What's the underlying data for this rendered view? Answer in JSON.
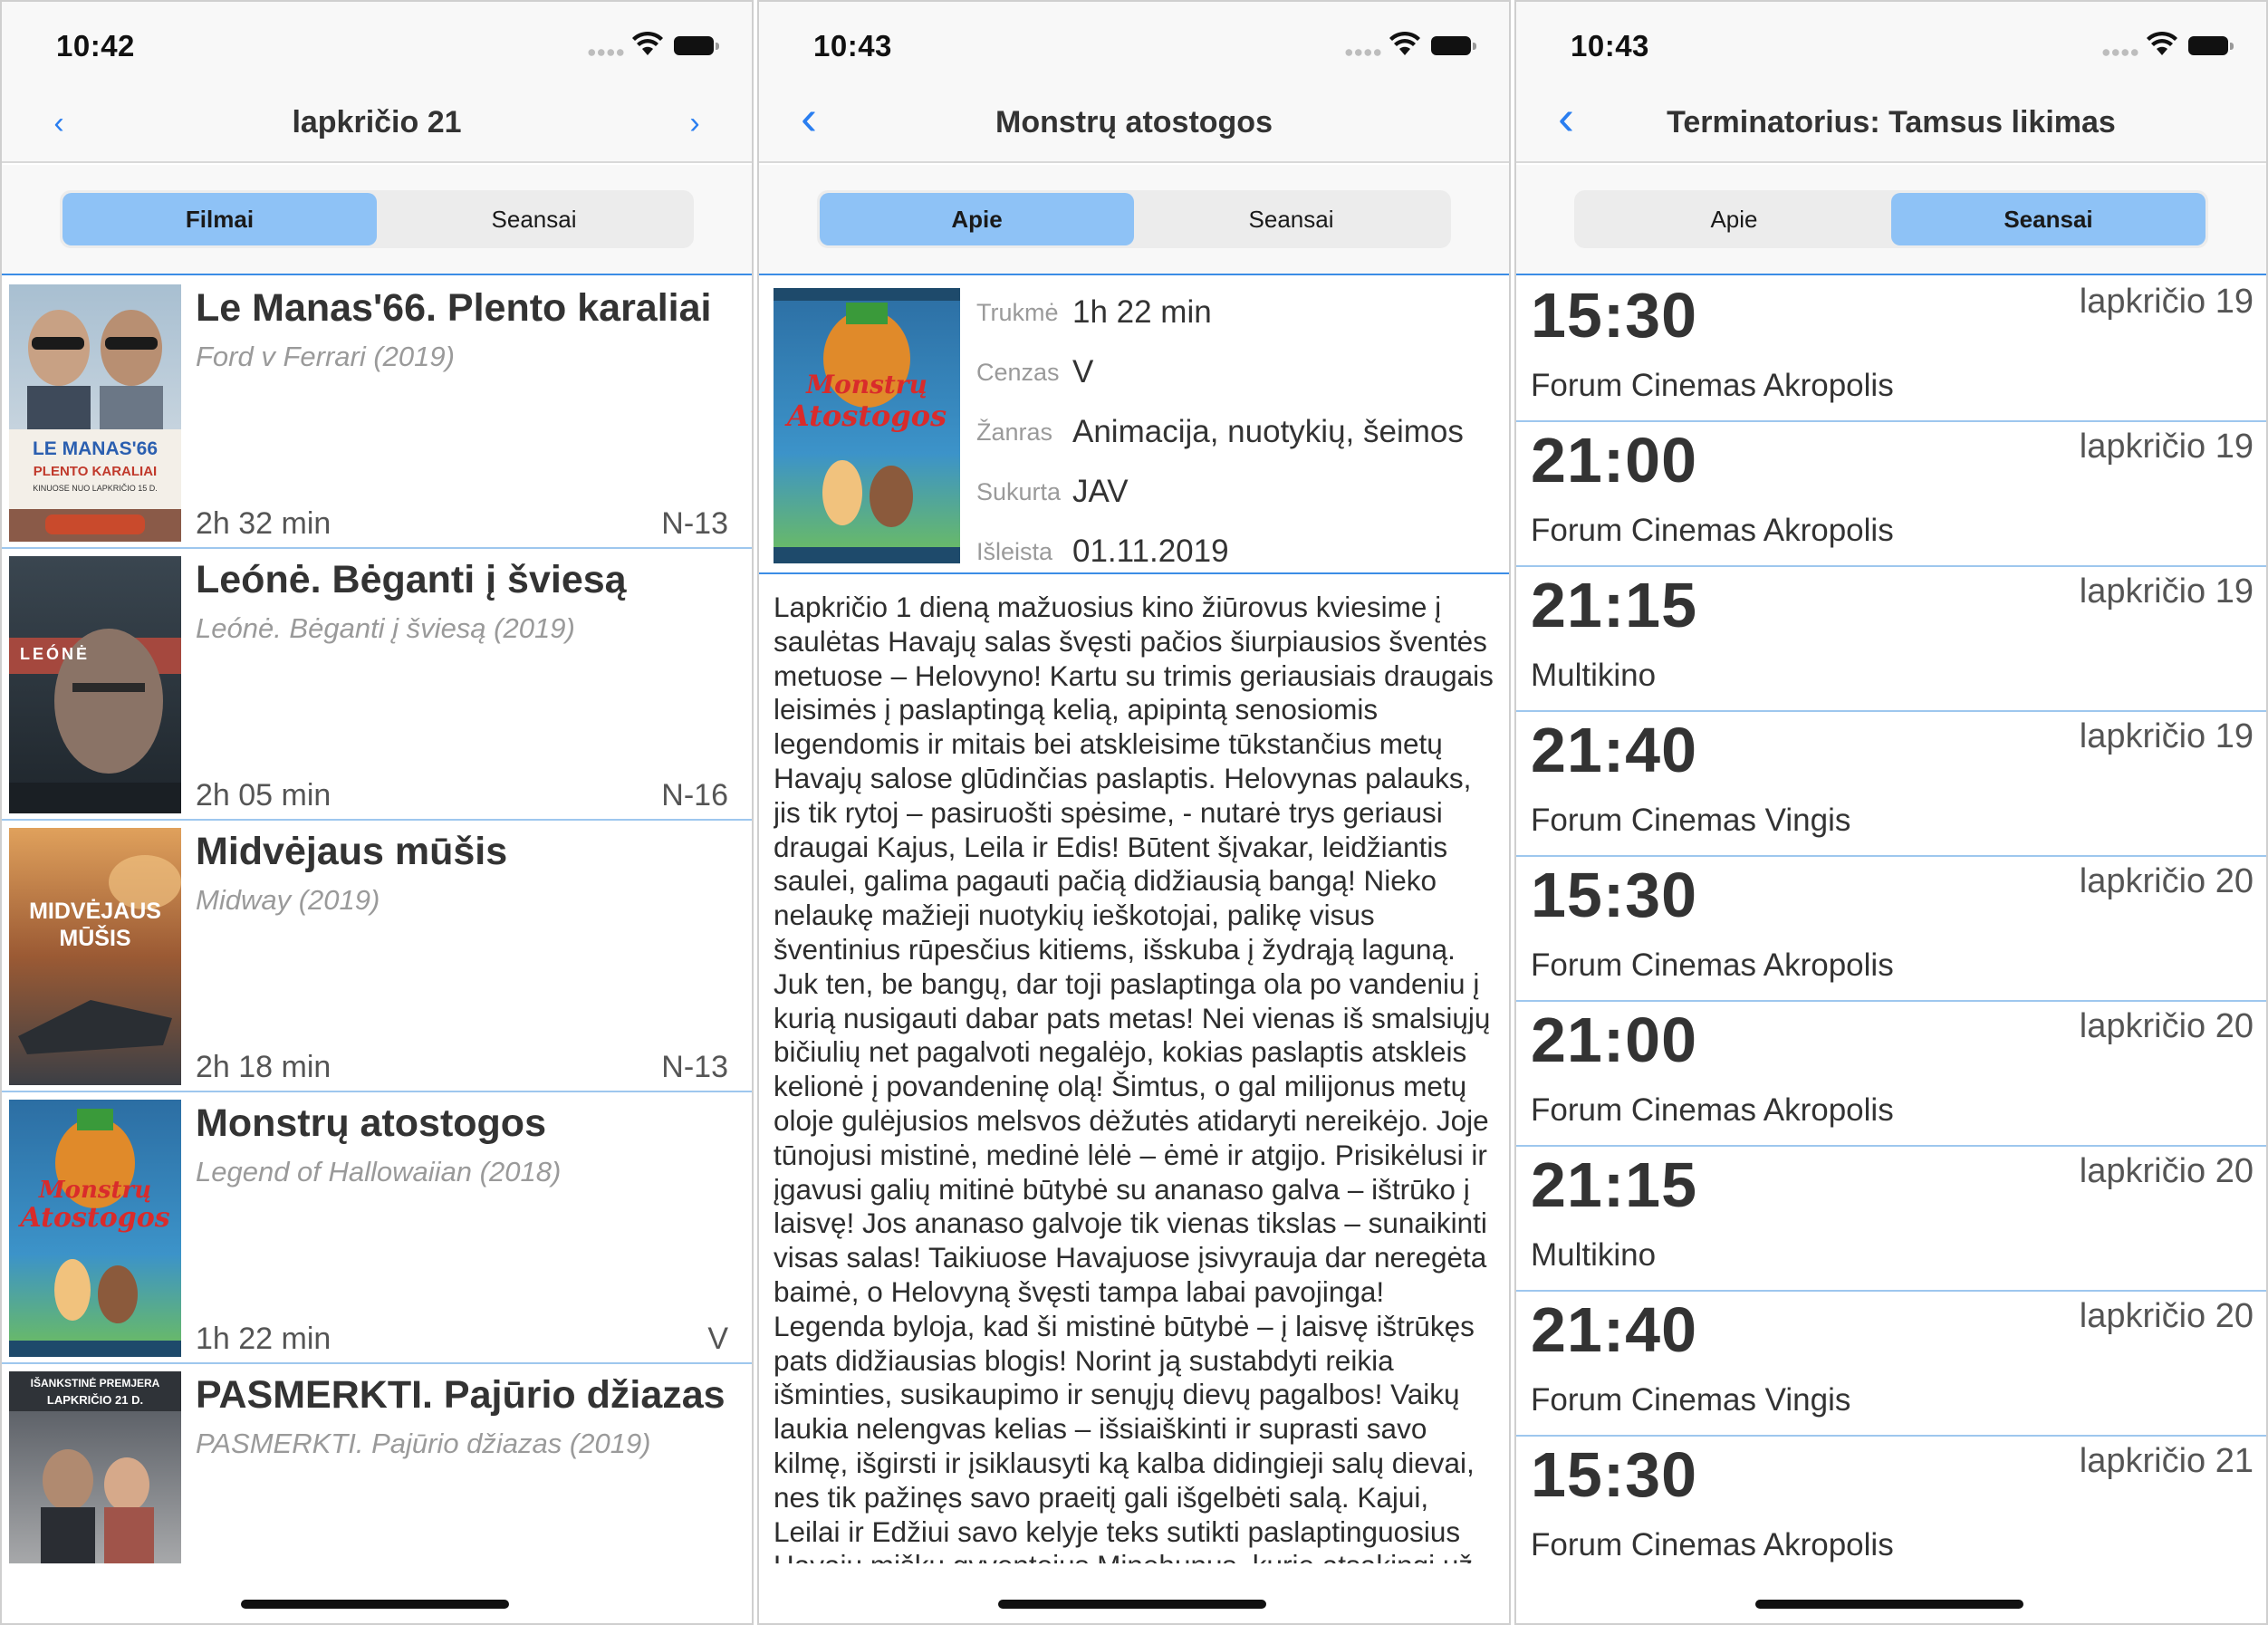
{
  "screens": [
    {
      "status": {
        "time": "10:42"
      },
      "nav": {
        "back": "‹",
        "title": "lapkričio 21",
        "forward": "›"
      },
      "tabs": [
        "Filmai",
        "Seansai"
      ],
      "active_tab": "Filmai",
      "movies": [
        {
          "title": "Le Manas'66. Plento karaliai",
          "original": "Ford v Ferrari (2019)",
          "duration": "2h 32 min",
          "rating": "N-13",
          "poster_text": "LE MANAS'66",
          "poster_sub": "PLENTO KARALIAI",
          "poster_colors": [
            "#9fb6c9",
            "#f0e9df"
          ]
        },
        {
          "title": "Leónė. Bėganti į šviesą",
          "original": "Leónė. Bėganti į šviesą (2019)",
          "duration": "2h 05 min",
          "rating": "N-16",
          "poster_text": "LEÓNĖ",
          "poster_sub": "",
          "poster_colors": [
            "#2f3a44",
            "#6b7780"
          ]
        },
        {
          "title": "Midvėjaus mūšis",
          "original": "Midway (2019)",
          "duration": "2h 18 min",
          "rating": "N-13",
          "poster_text": "MIDVĖJAUS",
          "poster_sub": "MŪŠIS",
          "poster_colors": [
            "#c87a3c",
            "#4a4f57"
          ]
        },
        {
          "title": "Monstrų atostogos",
          "original": "Legend of Hallowaiian (2018)",
          "duration": "1h 22 min",
          "rating": "V",
          "poster_text": "Monstrų",
          "poster_sub": "Atostogos",
          "poster_colors": [
            "#2f7fb5",
            "#9bd36b"
          ]
        },
        {
          "title": "PASMERKTI. Pajūrio džiazas",
          "original": "PASMERKTI. Pajūrio džiazas (2019)",
          "duration": "",
          "rating": "",
          "poster_text": "IŠANKSTINĖ  PREMJERA",
          "poster_sub": "LAPKRIČIO 21 D.",
          "poster_colors": [
            "#6a6e75",
            "#b7b7b7"
          ]
        }
      ]
    },
    {
      "status": {
        "time": "10:43"
      },
      "nav": {
        "back": "‹",
        "title": "Monstrų atostogos"
      },
      "tabs": [
        "Apie",
        "Seansai"
      ],
      "active_tab": "Apie",
      "details": [
        {
          "label": "Trukmė",
          "value": "1h 22 min"
        },
        {
          "label": "Cenzas",
          "value": "V"
        },
        {
          "label": "Žanras",
          "value": "Animacija, nuotykių, šeimos"
        },
        {
          "label": "Sukurta",
          "value": "JAV"
        },
        {
          "label": "Išleista",
          "value": "01.11.2019"
        }
      ],
      "poster_text": "Monstrų",
      "poster_sub": "Atostogos",
      "description": "Lapkričio 1 dieną mažuosius kino žiūrovus kviesime į saulėtas Havajų salas švęsti pačios šiurpiausios šventės metuose – Helovyno! Kartu su trimis geriausiais draugais leisimės į paslaptingą kelią, apipintą senosiomis legendomis ir mitais bei atskleisime tūkstančius metų Havajų salose glūdinčias paslaptis. Helovynas palauks, jis tik rytoj – pasiruošti spėsime, - nutarė trys geriausi draugai Kajus, Leila ir Edis! Būtent šįvakar, leidžiantis saulei, galima pagauti pačią didžiausią bangą! Nieko nelaukę mažieji nuotykių ieškotojai, palikę visus šventinius rūpesčius kitiems, išskuba į žydrąją laguną. Juk ten, be bangų, dar toji paslaptinga ola po vandeniu į kurią nusigauti dabar pats metas! Nei vienas iš smalsiųjų bičiulių net pagalvoti negalėjo, kokias paslaptis atskleis kelionė į povandeninę olą! Šimtus, o gal milijonus metų oloje gulėjusios melsvos dėžutės atidaryti nereikėjo. Joje tūnojusi mistinė, medinė lėlė – ėmė ir atgijo. Prisikėlusi ir įgavusi galių mitinė būtybė su ananaso galva – ištrūko į laisvę! Jos ananaso galvoje tik vienas tikslas – sunaikinti visas salas! Taikiuose Havajuose įsivyrauja dar neregėta baimė, o Helovyną švęsti tampa labai pavojinga! Legenda byloja, kad ši mistinė būtybė – į laisvę ištrūkęs pats didžiausias blogis! Norint ją sustabdyti reikia išminties, susikaupimo ir senųjų dievų pagalbos! Vaikų laukia nelengvas kelias – išsiaiškinti ir suprasti savo kilmę, išgirsti ir įsiklausyti ką kalba didingieji salų dievai, nes tik pažinęs savo praeitį gali išgelbėti salą. Kajui, Leilai ir Edžiui savo kelyje teks sutikti paslaptinguosius Havajų miškų gyventojus Minehunus, kurie atsakingi už visa, kas gražu ir"
    },
    {
      "status": {
        "time": "10:43"
      },
      "nav": {
        "back": "‹",
        "title": "Terminatorius: Tamsus likimas"
      },
      "tabs": [
        "Apie",
        "Seansai"
      ],
      "active_tab": "Seansai",
      "sessions": [
        {
          "time": "15:30",
          "date": "lapkričio 19",
          "cinema": "Forum Cinemas Akropolis"
        },
        {
          "time": "21:00",
          "date": "lapkričio 19",
          "cinema": "Forum Cinemas Akropolis"
        },
        {
          "time": "21:15",
          "date": "lapkričio 19",
          "cinema": "Multikino"
        },
        {
          "time": "21:40",
          "date": "lapkričio 19",
          "cinema": "Forum Cinemas Vingis"
        },
        {
          "time": "15:30",
          "date": "lapkričio 20",
          "cinema": "Forum Cinemas Akropolis"
        },
        {
          "time": "21:00",
          "date": "lapkričio 20",
          "cinema": "Forum Cinemas Akropolis"
        },
        {
          "time": "21:15",
          "date": "lapkričio 20",
          "cinema": "Multikino"
        },
        {
          "time": "21:40",
          "date": "lapkričio 20",
          "cinema": "Forum Cinemas Vingis"
        },
        {
          "time": "15:30",
          "date": "lapkričio 21",
          "cinema": "Forum Cinemas Akropolis"
        }
      ]
    }
  ],
  "colors": {
    "accent": "#2a7ef0",
    "segment_active": "#8ec2f6",
    "separator": "#9ec7ee"
  }
}
